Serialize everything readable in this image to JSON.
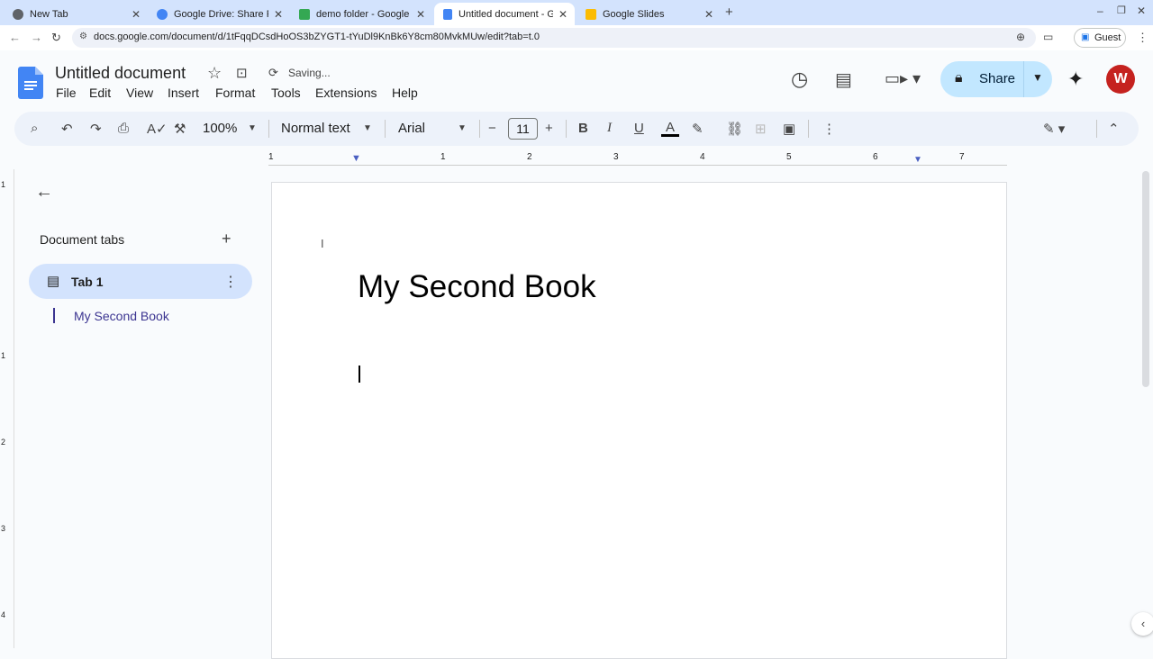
{
  "browser": {
    "tabs": [
      {
        "title": "New Tab",
        "color": "#5f6368"
      },
      {
        "title": "Google Drive: Share Files",
        "color": "#4285f4"
      },
      {
        "title": "demo folder - Google Drive",
        "color": "#34a853"
      },
      {
        "title": "Untitled document - Google Docs",
        "color": "#4285f4",
        "active": true
      },
      {
        "title": "Google Slides",
        "color": "#fbbc04"
      }
    ],
    "new_tab": "+",
    "url": "docs.google.com/document/d/1tFqqDCsdHoOS3bZYGT1-tYuDl9KnBk6Y8cm80MvkMUw/edit?tab=t.0",
    "profile": "Guest"
  },
  "doc": {
    "title": "Untitled document",
    "status": "Saving...",
    "menu": [
      "File",
      "Edit",
      "View",
      "Insert",
      "Format",
      "Tools",
      "Extensions",
      "Help"
    ],
    "share_label": "Share",
    "avatar": "W"
  },
  "toolbar": {
    "zoom": "100%",
    "style": "Normal text",
    "font": "Arial",
    "font_size": "11"
  },
  "ruler": {
    "labels": [
      "1",
      "1",
      "2",
      "3",
      "4",
      "5",
      "6",
      "7"
    ]
  },
  "vruler": {
    "labels": [
      "1",
      "1",
      "2",
      "3",
      "4"
    ]
  },
  "sidebar": {
    "heading": "Document tabs",
    "tab_label": "Tab 1",
    "outline": [
      "My Second Book"
    ]
  },
  "content": {
    "heading": "My Second Book"
  }
}
